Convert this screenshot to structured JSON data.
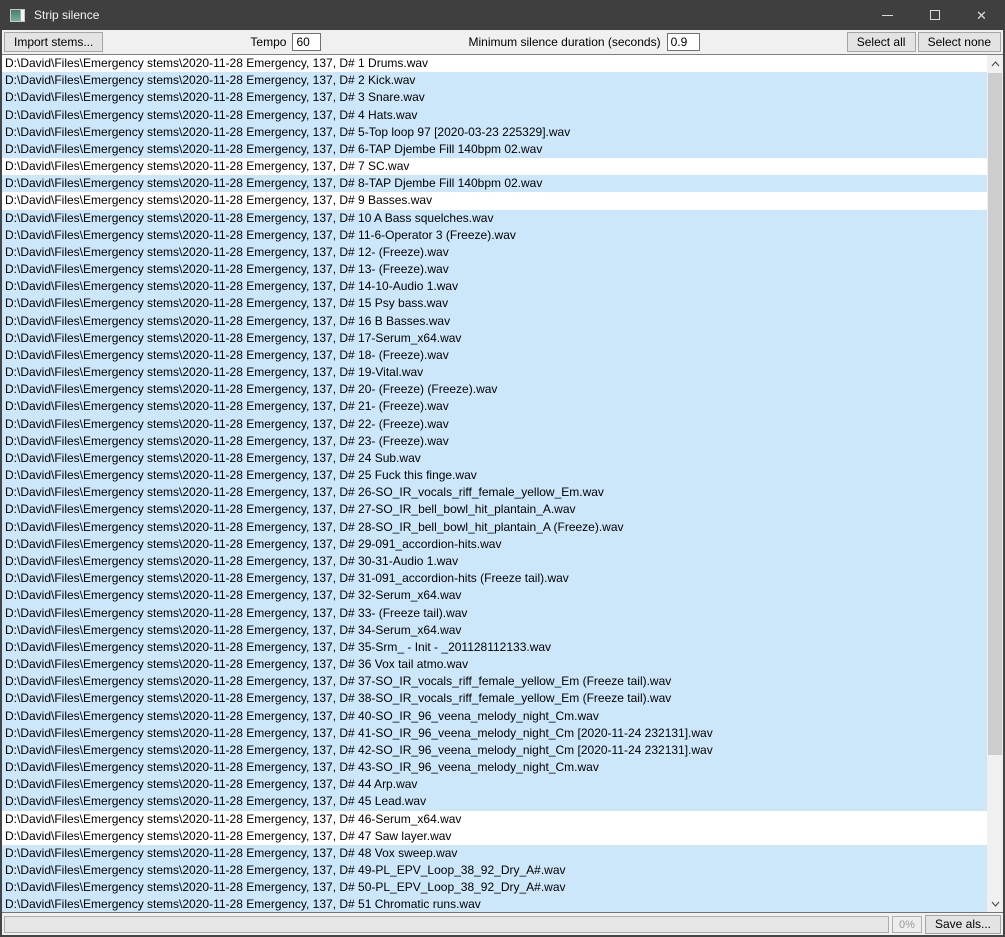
{
  "window": {
    "title": "Strip silence",
    "controls": {
      "close_icon": "✕"
    }
  },
  "toolbar": {
    "import_button": "Import stems...",
    "tempo_label": "Tempo",
    "tempo_value": "60",
    "min_silence_label": "Minimum silence duration (seconds)",
    "min_silence_value": "0.9",
    "select_all_button": "Select all",
    "select_none_button": "Select none"
  },
  "list": {
    "path_prefix": "D:\\David\\Files\\Emergency stems\\2020-11-28 Emergency, 137, D# ",
    "items": [
      {
        "name": "1 Drums.wav",
        "selected": false
      },
      {
        "name": "2 Kick.wav",
        "selected": true
      },
      {
        "name": "3 Snare.wav",
        "selected": true
      },
      {
        "name": "4 Hats.wav",
        "selected": true
      },
      {
        "name": "5-Top loop 97 [2020-03-23 225329].wav",
        "selected": true
      },
      {
        "name": "6-TAP Djembe Fill 140bpm 02.wav",
        "selected": true
      },
      {
        "name": "7 SC.wav",
        "selected": false
      },
      {
        "name": "8-TAP Djembe Fill 140bpm 02.wav",
        "selected": true
      },
      {
        "name": "9 Basses.wav",
        "selected": false
      },
      {
        "name": "10 A Bass squelches.wav",
        "selected": true
      },
      {
        "name": "11-6-Operator 3 (Freeze).wav",
        "selected": true
      },
      {
        "name": "12- (Freeze).wav",
        "selected": true
      },
      {
        "name": "13- (Freeze).wav",
        "selected": true
      },
      {
        "name": "14-10-Audio 1.wav",
        "selected": true
      },
      {
        "name": "15 Psy bass.wav",
        "selected": true
      },
      {
        "name": "16 B Basses.wav",
        "selected": true
      },
      {
        "name": "17-Serum_x64.wav",
        "selected": true
      },
      {
        "name": "18- (Freeze).wav",
        "selected": true
      },
      {
        "name": "19-Vital.wav",
        "selected": true
      },
      {
        "name": "20- (Freeze) (Freeze).wav",
        "selected": true
      },
      {
        "name": "21- (Freeze).wav",
        "selected": true
      },
      {
        "name": "22- (Freeze).wav",
        "selected": true
      },
      {
        "name": "23- (Freeze).wav",
        "selected": true
      },
      {
        "name": "24 Sub.wav",
        "selected": true
      },
      {
        "name": "25 Fuck this finge.wav",
        "selected": true
      },
      {
        "name": "26-SO_IR_vocals_riff_female_yellow_Em.wav",
        "selected": true
      },
      {
        "name": "27-SO_IR_bell_bowl_hit_plantain_A.wav",
        "selected": true
      },
      {
        "name": "28-SO_IR_bell_bowl_hit_plantain_A (Freeze).wav",
        "selected": true
      },
      {
        "name": "29-091_accordion-hits.wav",
        "selected": true
      },
      {
        "name": "30-31-Audio 1.wav",
        "selected": true
      },
      {
        "name": "31-091_accordion-hits (Freeze tail).wav",
        "selected": true
      },
      {
        "name": "32-Serum_x64.wav",
        "selected": true
      },
      {
        "name": "33- (Freeze tail).wav",
        "selected": true
      },
      {
        "name": "34-Serum_x64.wav",
        "selected": true
      },
      {
        "name": "35-Srm_ - Init - _201128112133.wav",
        "selected": true
      },
      {
        "name": "36 Vox tail atmo.wav",
        "selected": true
      },
      {
        "name": "37-SO_IR_vocals_riff_female_yellow_Em (Freeze tail).wav",
        "selected": true
      },
      {
        "name": "38-SO_IR_vocals_riff_female_yellow_Em (Freeze tail).wav",
        "selected": true
      },
      {
        "name": "40-SO_IR_96_veena_melody_night_Cm.wav",
        "selected": true
      },
      {
        "name": "41-SO_IR_96_veena_melody_night_Cm [2020-11-24 232131].wav",
        "selected": true
      },
      {
        "name": "42-SO_IR_96_veena_melody_night_Cm [2020-11-24 232131].wav",
        "selected": true
      },
      {
        "name": "43-SO_IR_96_veena_melody_night_Cm.wav",
        "selected": true
      },
      {
        "name": "44 Arp.wav",
        "selected": true
      },
      {
        "name": "45 Lead.wav",
        "selected": true
      },
      {
        "name": "46-Serum_x64.wav",
        "selected": false
      },
      {
        "name": "47 Saw layer.wav",
        "selected": false
      },
      {
        "name": "48 Vox sweep.wav",
        "selected": true
      },
      {
        "name": "49-PL_EPV_Loop_38_92_Dry_A#.wav",
        "selected": true
      },
      {
        "name": "50-PL_EPV_Loop_38_92_Dry_A#.wav",
        "selected": true
      },
      {
        "name": "51 Chromatic runs.wav",
        "selected": true
      }
    ]
  },
  "statusbar": {
    "progress_percent": "0%",
    "save_button": "Save als..."
  },
  "colors": {
    "titlebar_bg": "#3f3f3f",
    "selection_blue": "#cde7fa",
    "toolbar_bg": "#f0f0f0",
    "scroll_thumb": "#cdcdcd"
  }
}
